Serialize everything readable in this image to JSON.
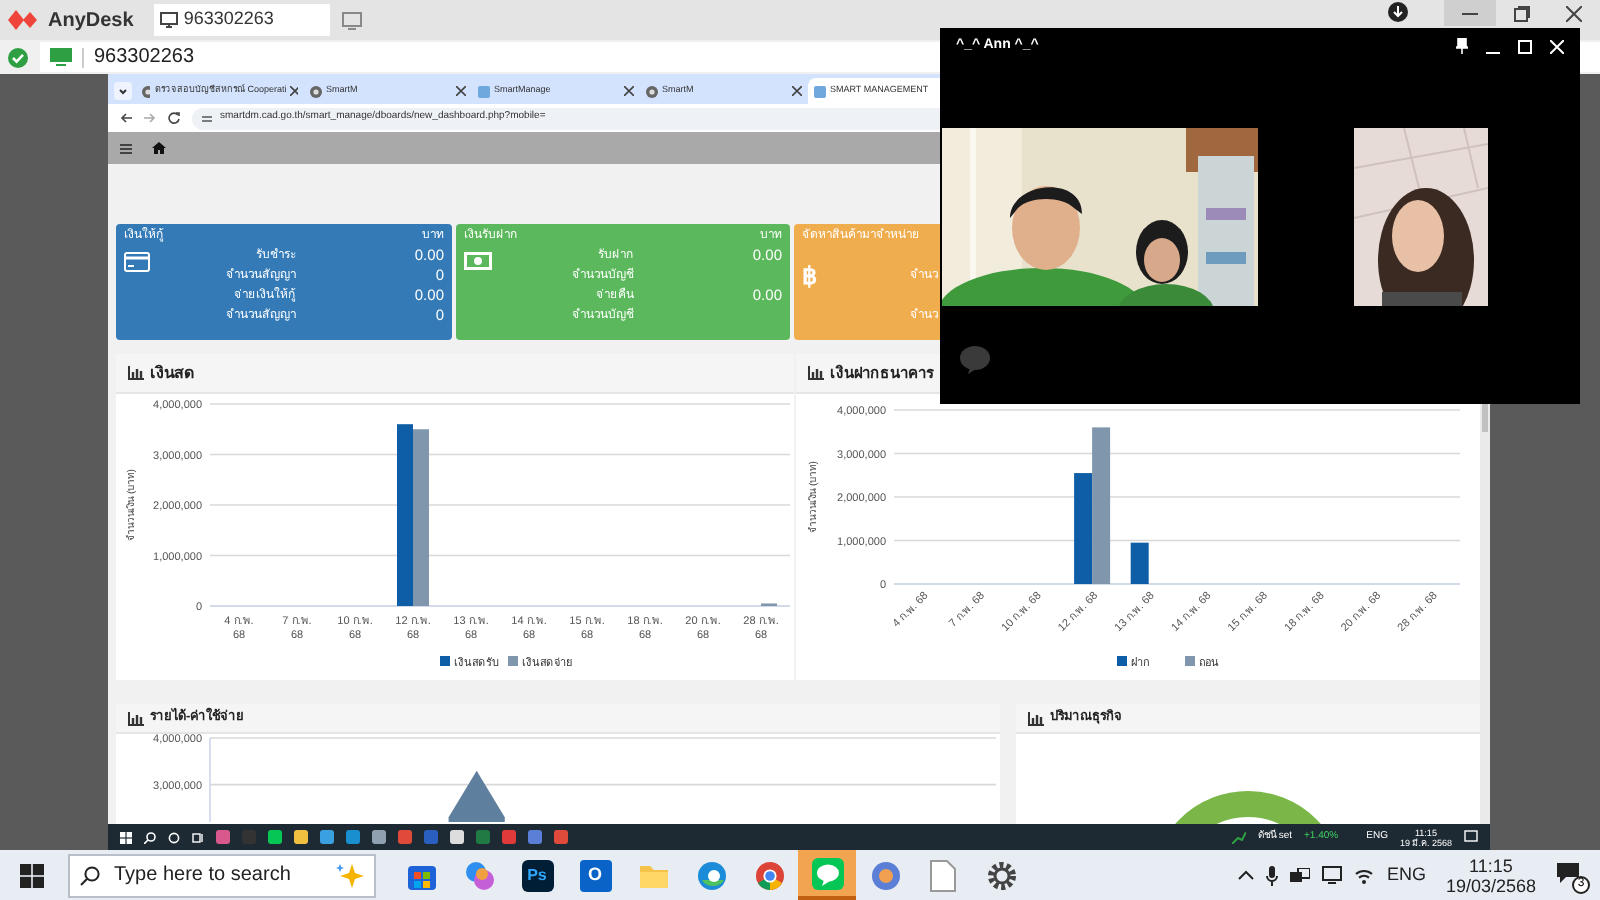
{
  "anydesk": {
    "app_name": "AnyDesk",
    "tab": "963302263",
    "address": "963302263"
  },
  "browser": {
    "tabs": [
      {
        "label": "ตรวจสอบบัญชีสหกรณ์ Cooperati",
        "selected": false
      },
      {
        "label": "SmartM",
        "selected": false
      },
      {
        "label": "SmartManage",
        "selected": false
      },
      {
        "label": "SmartM",
        "selected": false
      },
      {
        "label": "SMART MANAGEMENT",
        "selected": true
      }
    ],
    "url": "smartdm.cad.go.th/smart_manage/dboards/new_dashboard.php?mobile="
  },
  "cards": [
    {
      "kind": "card",
      "title": "เงินให้กู้",
      "unit": "บาท",
      "color": "#337ab7",
      "rows": [
        {
          "label": "รับชำระ",
          "value": "0.00"
        },
        {
          "label": "จำนวนสัญญา",
          "value": "0"
        },
        {
          "label": "จ่ายเงินให้กู้",
          "value": "0.00"
        },
        {
          "label": "จำนวนสัญญา",
          "value": "0"
        }
      ]
    },
    {
      "kind": "cash",
      "title": "เงินรับฝาก",
      "unit": "บาท",
      "color": "#5cb85c",
      "rows": [
        {
          "label": "รับฝาก",
          "value": "0.00"
        },
        {
          "label": "จำนวนบัญชี"
        },
        {
          "label": "จ่ายคืน",
          "value": "0.00"
        },
        {
          "label": "จำนวนบัญชี"
        }
      ]
    },
    {
      "kind": "coin",
      "title": "จัดหาสินค้ามาจำหน่าย",
      "icon": "฿",
      "color": "#f0ad4e",
      "rows": [
        {
          "label": ""
        },
        {
          "label": "จำนว"
        },
        {
          "label": ""
        },
        {
          "label": "จำนว"
        }
      ]
    }
  ],
  "panels": [
    {
      "kind": "bar",
      "title": "เงินสด",
      "chart_data": {
        "type": "bar",
        "grid": true,
        "legend": true,
        "ylabel": "จำนวนเงิน (บาท)",
        "categories": [
          "4 ก.พ. 68",
          "7 ก.พ. 68",
          "10 ก.พ. 68",
          "12 ก.พ. 68",
          "13 ก.พ. 68",
          "14 ก.พ. 68",
          "15 ก.พ. 68",
          "18 ก.พ. 68",
          "20 ก.พ. 68",
          "28 ก.พ. 68"
        ],
        "ylim": [
          0,
          4000000
        ],
        "yticks": [
          {
            "value": 0,
            "label": "0"
          },
          {
            "value": 1000000,
            "label": "1,000,000"
          },
          {
            "value": 2000000,
            "label": "2,000,000"
          },
          {
            "value": 3000000,
            "label": "3,000,000"
          },
          {
            "value": 4000000,
            "label": "4,000,000"
          }
        ],
        "series": [
          {
            "name": "เงินสดรับ",
            "color": "#0d5ea6",
            "values": [
              0,
              0,
              0,
              3600000,
              0,
              0,
              0,
              0,
              0,
              0
            ]
          },
          {
            "name": "เงินสดจ่าย",
            "color": "#7f96ad",
            "values": [
              0,
              0,
              0,
              3500000,
              0,
              0,
              0,
              0,
              0,
              50000
            ]
          }
        ]
      }
    },
    {
      "kind": "bar",
      "title": "เงินฝากธนาคาร",
      "chart_data": {
        "type": "bar",
        "grid": true,
        "legend": true,
        "ylabel": "จำนวนเงิน (บาท)",
        "categories": [
          "4 ก.พ. 68",
          "7 ก.พ. 68",
          "10 ก.พ. 68",
          "12 ก.พ. 68",
          "13 ก.พ. 68",
          "14 ก.พ. 68",
          "15 ก.พ. 68",
          "18 ก.พ. 68",
          "20 ก.พ. 68",
          "28 ก.พ. 68"
        ],
        "ylim": [
          0,
          4000000
        ],
        "yticks": [
          {
            "value": 0,
            "label": "0"
          },
          {
            "value": 1000000,
            "label": "1,000,000"
          },
          {
            "value": 2000000,
            "label": "2,000,000"
          },
          {
            "value": 3000000,
            "label": "3,000,000"
          },
          {
            "value": 4000000,
            "label": "4,000,000"
          }
        ],
        "series": [
          {
            "name": "ฝาก",
            "color": "#0d5ea6",
            "values": [
              0,
              0,
              0,
              2550000,
              950000,
              0,
              0,
              0,
              0,
              0
            ]
          },
          {
            "name": "ถอน",
            "color": "#7f96ad",
            "values": [
              0,
              0,
              0,
              3600000,
              0,
              0,
              0,
              0,
              0,
              0
            ]
          }
        ]
      }
    },
    {
      "kind": "area",
      "title": "รายได้-ค่าใช้จ่าย",
      "chart_data": {
        "type": "area",
        "grid": true,
        "ylim": [
          2200000,
          4000000
        ],
        "yticks": [
          {
            "value": 3000000,
            "label": "3,000,000"
          },
          {
            "value": 4000000,
            "label": "4,000,000"
          }
        ],
        "series": [
          {
            "color": "#5f7f9e",
            "values": [
              null,
              null,
              null,
              null,
              null,
              null,
              null,
              null,
              2300000,
              3300000,
              2300000,
              null,
              null,
              null,
              null,
              null,
              null,
              null,
              null,
              null,
              null,
              null,
              null,
              null,
              null,
              null,
              null,
              null
            ]
          }
        ]
      }
    },
    {
      "kind": "donut",
      "title": "ปริมาณธุรกิจ"
    }
  ],
  "line_call": {
    "title": "^_^ Ann ^_^"
  },
  "remote_taskbar": {
    "index_label": "ดัชนี set",
    "index_change": "+1.40%",
    "lang": "ENG",
    "time": "11:15",
    "date": "19 มี.ค. 2568"
  },
  "taskbar": {
    "search_placeholder": "Type here to search",
    "apps": [
      {
        "kind": "store",
        "selected": false
      },
      {
        "kind": "copilot",
        "selected": false
      },
      {
        "kind": "photoshop",
        "glyph": "Ps",
        "selected": false
      },
      {
        "kind": "outlook",
        "glyph": "O",
        "selected": false
      },
      {
        "kind": "files",
        "selected": false
      },
      {
        "kind": "edge",
        "selected": false
      },
      {
        "kind": "chrome",
        "selected": false
      },
      {
        "kind": "line",
        "selected": true
      },
      {
        "kind": "globe",
        "selected": false
      },
      {
        "kind": "document",
        "selected": false
      },
      {
        "kind": "settings",
        "selected": false
      }
    ],
    "lang": "ENG",
    "time": "11:15",
    "date": "19/03/2568",
    "notifications": "3"
  }
}
